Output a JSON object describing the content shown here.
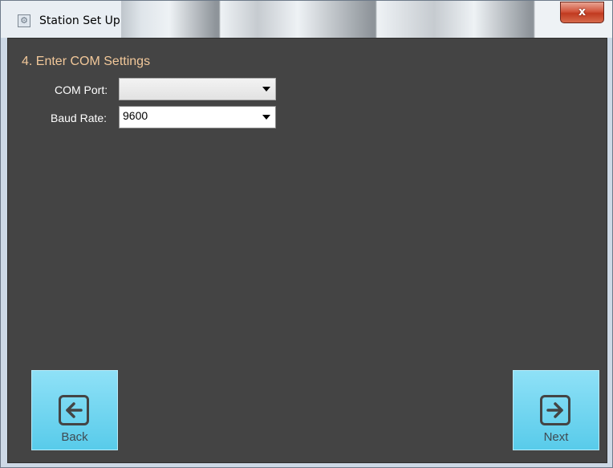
{
  "window": {
    "title": "Station Set Up",
    "close_label": "x"
  },
  "step": {
    "title": "4. Enter COM Settings"
  },
  "fields": {
    "com_port": {
      "label": "COM Port:",
      "value": ""
    },
    "baud_rate": {
      "label": "Baud Rate:",
      "value": "9600"
    }
  },
  "buttons": {
    "back_label": "Back",
    "next_label": "Next"
  },
  "icons": {
    "app": "gear-icon",
    "close": "close-icon",
    "back": "arrow-left-icon",
    "next": "arrow-right-icon",
    "dropdown": "chevron-down-icon"
  },
  "colors": {
    "panel_background": "#444444",
    "step_title": "#f2c89a",
    "nav_button": "#7dd8f0",
    "close_button": "#c94a30"
  }
}
